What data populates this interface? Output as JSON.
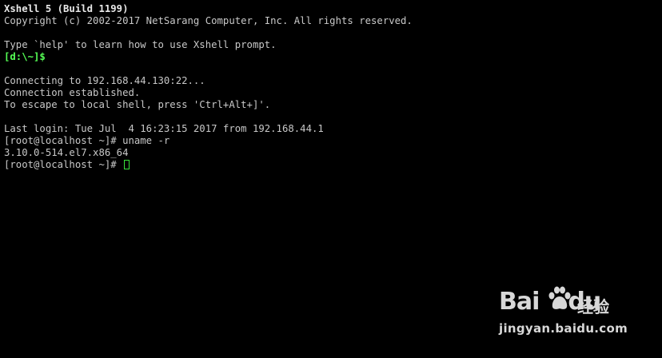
{
  "terminal": {
    "lines": [
      "Xshell 5 (Build 1199)",
      "Copyright (c) 2002-2017 NetSarang Computer, Inc. All rights reserved.",
      "",
      "Type `help' to learn how to use Xshell prompt.",
      "[d:\\~]$",
      "",
      "Connecting to 192.168.44.130:22...",
      "Connection established.",
      "To escape to local shell, press 'Ctrl+Alt+]'.",
      "",
      "Last login: Tue Jul  4 16:23:15 2017 from 192.168.44.1",
      "[root@localhost ~]# uname -r",
      "3.10.0-514.el7.x86_64",
      "[root@localhost ~]# "
    ],
    "colors": {
      "background": "#000000",
      "text": "#c8c8c8",
      "local_prompt": "#55ff55",
      "cursor": "#39e53b"
    }
  },
  "watermark": {
    "brand": "Bai",
    "brand_tail": "du",
    "chinese": "经验",
    "url": "jingyan.baidu.com",
    "icon": "paw-icon"
  }
}
